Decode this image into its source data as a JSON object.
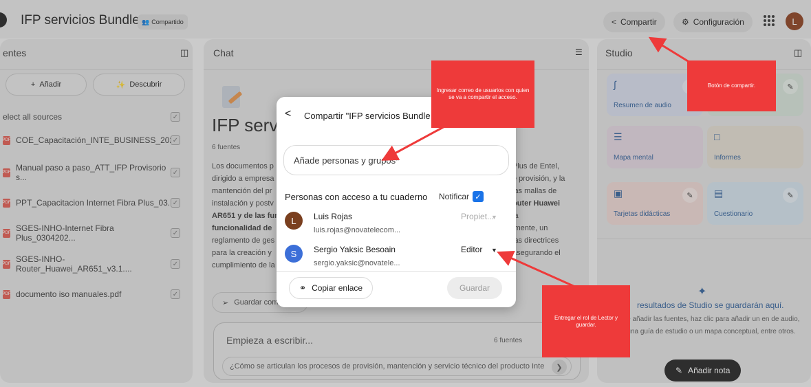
{
  "header": {
    "title": "IFP servicios Bundle",
    "shared_label": "Compartido",
    "share_label": "Compartir",
    "config_label": "Configuración",
    "avatar_letter": "L"
  },
  "sources": {
    "title": "entes",
    "add_label": "Añadir",
    "discover_label": "Descubrir",
    "select_all": "elect all sources",
    "items": [
      "COE_Capacitación_INTE_BUSINESS_202...",
      "Manual paso a paso_ATT_IFP Provisorio s...",
      "PPT_Capacitacion Internet Fibra Plus_03...",
      "SGES-INHO-Internet Fibra Plus_0304202...",
      "SGES-INHO-Router_Huawei_AR651_v3.1....",
      "documento iso manuales.pdf"
    ]
  },
  "chat": {
    "title": "Chat",
    "heading": "IFP servi",
    "source_count": "6 fuentes",
    "summary_left": [
      "Los documentos p",
      "dirigido a empresa",
      "mantención del pr",
      "instalación y postv",
      "AR651 y de las fun",
      "funcionalidad de",
      "reglamento de ges",
      "para la creación y",
      "cumplimiento de la"
    ],
    "summary_right": [
      "Plus de Entel,",
      "e provisión, y la",
      "las mallas de",
      "outer Huawei",
      "la",
      "lmente, un",
      "las directrices",
      "asegurando el"
    ],
    "save_chip": "Guardar com",
    "input_placeholder": "Empieza a escribir...",
    "input_count": "6 fuentes",
    "suggestion": "¿Cómo se articulan los procesos de provisión, mantención y servicio técnico del producto Inte"
  },
  "studio": {
    "title": "Studio",
    "cards": [
      {
        "label": "Resumen de audio",
        "icon": "audio-wave-icon",
        "color": "#d7dcec"
      },
      {
        "label": "",
        "icon": "video-icon",
        "color": "#d6e3d8"
      },
      {
        "label": "Mapa mental",
        "icon": "mind-map-icon",
        "color": "#e3d6e0"
      },
      {
        "label": "Informes",
        "icon": "report-icon",
        "color": "#e3ddd0"
      },
      {
        "label": "Tarjetas didácticas",
        "icon": "flashcards-icon",
        "color": "#eed7d3"
      },
      {
        "label": "Cuestionario",
        "icon": "quiz-icon",
        "color": "#d3e2ec"
      }
    ],
    "note_title": "resultados de Studio se guardarán aquí.",
    "note_body": "de añadir las fuentes, haz clic para añadir un en de audio, una guía de estudio o un mapa conceptual, entre otros.",
    "add_note": "Añadir nota"
  },
  "dialog": {
    "title": "Compartir \"IFP servicios Bundle",
    "input_placeholder": "Añade personas y grupos*",
    "access_title": "Personas con acceso a tu cuaderno",
    "notify_label": "Notificar",
    "people": [
      {
        "initial": "L",
        "name": "Luis Rojas",
        "email": "luis.rojas@novatelecom...",
        "role": "Propiet...",
        "avatar_color": "#7a3f1f"
      },
      {
        "initial": "S",
        "name": "Sergio Yaksic Besoain",
        "email": "sergio.yaksic@novatele...",
        "role": "Editor",
        "avatar_color": "#3c6fd8"
      }
    ],
    "copy_link": "Copiar enlace",
    "save": "Guardar"
  },
  "annotations": {
    "input_note": "Ingresar correo de usuarios con quien se va a compartir el acceso.",
    "share_note": "Botón de compartir.",
    "role_note": "Entregar el rol de Lector y guardar.",
    "color": "#ee3a3a"
  }
}
